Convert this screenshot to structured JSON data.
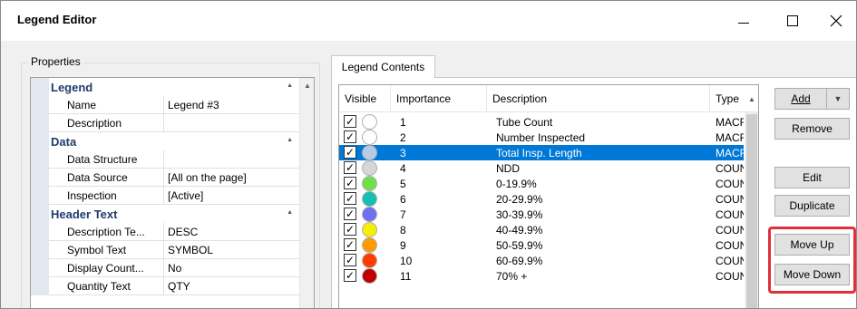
{
  "window": {
    "title": "Legend Editor"
  },
  "properties": {
    "group_label": "Properties",
    "categories": [
      {
        "name": "Legend",
        "rows": [
          {
            "name": "Name",
            "value": "Legend #3"
          },
          {
            "name": "Description",
            "value": ""
          }
        ]
      },
      {
        "name": "Data",
        "rows": [
          {
            "name": "Data Structure",
            "value": ""
          },
          {
            "name": "Data Source",
            "value": "[All on the page]"
          },
          {
            "name": "Inspection",
            "value": "[Active]"
          }
        ]
      },
      {
        "name": "Header Text",
        "rows": [
          {
            "name": "Description Te...",
            "value": "DESC"
          },
          {
            "name": "Symbol Text",
            "value": "SYMBOL"
          },
          {
            "name": "Display Count...",
            "value": "No"
          },
          {
            "name": "Quantity Text",
            "value": "QTY"
          }
        ]
      }
    ]
  },
  "tab": {
    "label": "Legend Contents"
  },
  "legend_list": {
    "columns": {
      "visible": "Visible",
      "importance": "Importance",
      "description": "Description",
      "type": "Type"
    },
    "selected_index": 2,
    "rows": [
      {
        "checked": true,
        "color": "#ffffff",
        "importance": "1",
        "description": "Tube Count",
        "type": "MACRO"
      },
      {
        "checked": true,
        "color": "#ffffff",
        "importance": "2",
        "description": "Number Inspected",
        "type": "MACRO"
      },
      {
        "checked": true,
        "color": "#b5cbe8",
        "importance": "3",
        "description": "Total Insp. Length",
        "type": "MACRO"
      },
      {
        "checked": true,
        "color": "#d6d6d6",
        "importance": "4",
        "description": "NDD",
        "type": "COUNT"
      },
      {
        "checked": true,
        "color": "#6fe04a",
        "importance": "5",
        "description": "0-19.9%",
        "type": "COUNT"
      },
      {
        "checked": true,
        "color": "#14c0b0",
        "importance": "6",
        "description": "20-29.9%",
        "type": "COUNT"
      },
      {
        "checked": true,
        "color": "#6f6ff2",
        "importance": "7",
        "description": "30-39.9%",
        "type": "COUNT"
      },
      {
        "checked": true,
        "color": "#f5f000",
        "importance": "8",
        "description": "40-49.9%",
        "type": "COUNT"
      },
      {
        "checked": true,
        "color": "#ff9a00",
        "importance": "9",
        "description": "50-59.9%",
        "type": "COUNT"
      },
      {
        "checked": true,
        "color": "#ff3c00",
        "importance": "10",
        "description": "60-69.9%",
        "type": "COUNT"
      },
      {
        "checked": true,
        "color": "#c00000",
        "importance": "11",
        "description": "70% +",
        "type": "COUNT"
      }
    ]
  },
  "buttons": {
    "add": "Add",
    "remove": "Remove",
    "edit": "Edit",
    "duplicate": "Duplicate",
    "move_up": "Move Up",
    "move_down": "Move Down"
  },
  "colors": {
    "selection": "#0078d7",
    "highlight": "#e0303a",
    "category_text": "#1f3b6e"
  }
}
